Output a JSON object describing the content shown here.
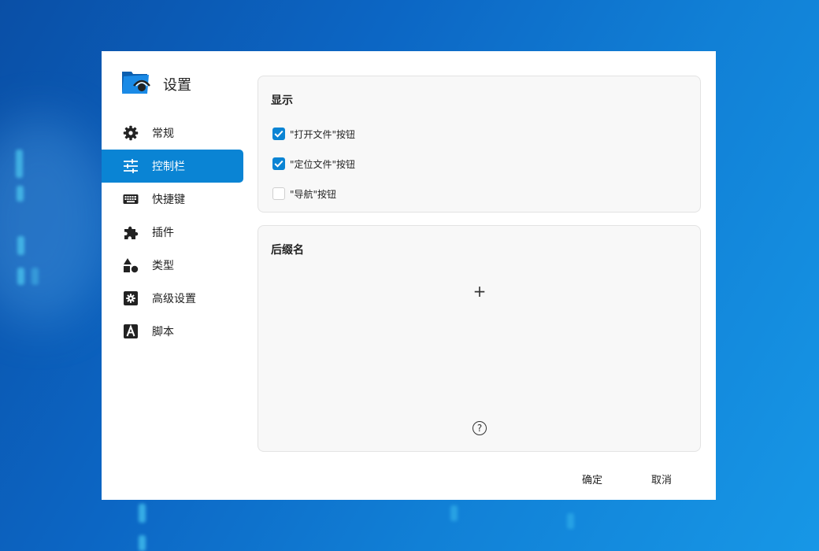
{
  "app": {
    "title": "设置",
    "icon": "folder-eye-icon"
  },
  "nav": {
    "items": [
      {
        "label": "常规",
        "icon": "gear-icon",
        "active": false
      },
      {
        "label": "控制栏",
        "icon": "sliders-icon",
        "active": true
      },
      {
        "label": "快捷键",
        "icon": "keyboard-icon",
        "active": false
      },
      {
        "label": "插件",
        "icon": "puzzle-icon",
        "active": false
      },
      {
        "label": "类型",
        "icon": "shapes-icon",
        "active": false
      },
      {
        "label": "高级设置",
        "icon": "advanced-gear-icon",
        "active": false
      },
      {
        "label": "脚本",
        "icon": "script-icon",
        "active": false
      }
    ]
  },
  "display_section": {
    "title": "显示",
    "options": [
      {
        "label": "\"打开文件\"按钮",
        "checked": true
      },
      {
        "label": "\"定位文件\"按钮",
        "checked": true
      },
      {
        "label": "\"导航\"按钮",
        "checked": false
      }
    ]
  },
  "suffix_section": {
    "title": "后缀名",
    "add_symbol": "+",
    "help_symbol": "?"
  },
  "footer": {
    "ok_label": "确定",
    "cancel_label": "取消"
  },
  "colors": {
    "accent": "#0a84d4",
    "background_blue": "#0c66c4"
  }
}
